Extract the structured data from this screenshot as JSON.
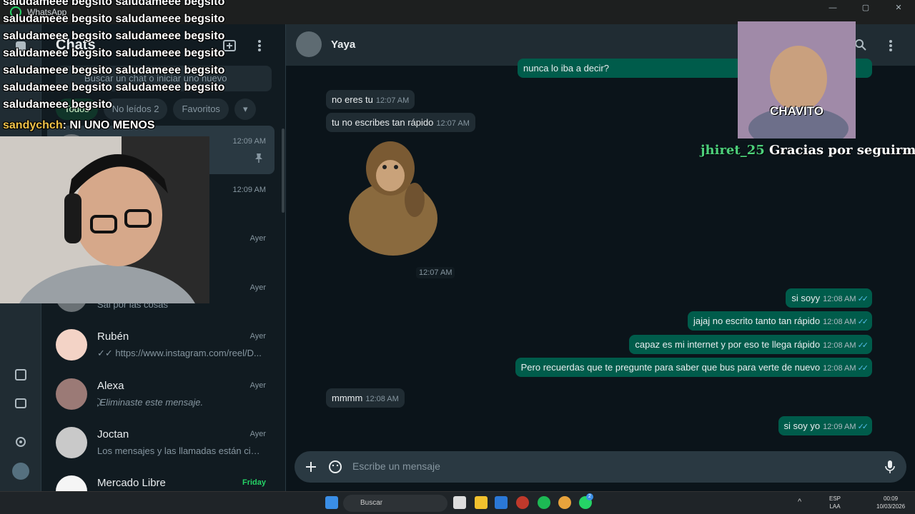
{
  "window": {
    "app_name": "WhatsApp",
    "controls": [
      "—",
      "▢",
      "✕"
    ]
  },
  "chatlist": {
    "title": "Chats",
    "search_placeholder": "Buscar un chat o iniciar uno nuevo",
    "filters": [
      {
        "label": "Todos"
      },
      {
        "label": "No leídos 2"
      },
      {
        "label": "Favoritos"
      }
    ],
    "chats": [
      {
        "name": "",
        "time": "12:09 AM",
        "preview": "",
        "selected": true,
        "pinned": true
      },
      {
        "name": "",
        "time": "12:09 AM",
        "preview": ""
      },
      {
        "name": "",
        "time": "Ayer",
        "preview": ""
      },
      {
        "name": "",
        "time": "Ayer",
        "preview": "Sal por las cosas"
      },
      {
        "name": "Rubén",
        "time": "Ayer",
        "preview": "✓✓ https://www.instagram.com/reel/D..."
      },
      {
        "name": "Alexa",
        "time": "Ayer",
        "preview": "⃠ Eliminaste este mensaje."
      },
      {
        "name": "Joctan",
        "time": "Ayer",
        "preview": "Los mensajes y las llamadas están cifr..."
      },
      {
        "name": "Mercado Libre",
        "time": "Friday",
        "preview": ""
      }
    ]
  },
  "conversation": {
    "contact_name": "Yaya",
    "messages": [
      {
        "dir": "out",
        "text": "nunca lo iba a decir?",
        "time": ""
      },
      {
        "dir": "in",
        "text": "no eres tu",
        "time": "12:07 AM"
      },
      {
        "dir": "in",
        "text": "tu no escribes tan rápido",
        "time": "12:07 AM"
      },
      {
        "dir": "in",
        "text": "",
        "time": "12:07 AM",
        "sticker": "monkey-sticker"
      },
      {
        "dir": "out",
        "text": "si soyy",
        "time": "12:08 AM"
      },
      {
        "dir": "out",
        "text": "jajaj no escrito tanto tan rápido",
        "time": "12:08 AM"
      },
      {
        "dir": "out",
        "text": "capaz es mi internet y por eso te llega rápido",
        "time": "12:08 AM"
      },
      {
        "dir": "out",
        "text": "Pero recuerdas que te pregunte para saber que bus para verte de nuevo",
        "time": "12:08 AM"
      },
      {
        "dir": "in",
        "text": "mmmm",
        "time": "12:08 AM"
      },
      {
        "dir": "out",
        "text": "si soy yo",
        "time": "12:09 AM"
      }
    ],
    "composer_placeholder": "Escribe un mensaje"
  },
  "stream_overlay": {
    "spam_lines": [
      "saludameee begsito saludameee begsito",
      "saludameee begsito saludameee begsito",
      "saludameee begsito saludameee begsito",
      "saludameee begsito saludameee begsito",
      "saludameee begsito saludameee begsito",
      "saludameee begsito saludameee begsito",
      "saludameee begsito"
    ],
    "chat_user": "sandychch",
    "chat_msg": ": NI UNO MENOS",
    "alert_label": "CHAVITO",
    "follower": "jhiret_25",
    "follow_msg": "Gracias por seguirme!!"
  },
  "taskbar": {
    "search_placeholder": "Buscar",
    "lang_top": "ESP",
    "lang_bottom": "LAA",
    "clock_time": "00:09",
    "clock_date": "10/03/2026",
    "badge": "2"
  },
  "colors": {
    "accent": "#25d366",
    "bubble_out": "#005c4b",
    "bubble_in": "#202c33",
    "background": "#0b141a"
  }
}
